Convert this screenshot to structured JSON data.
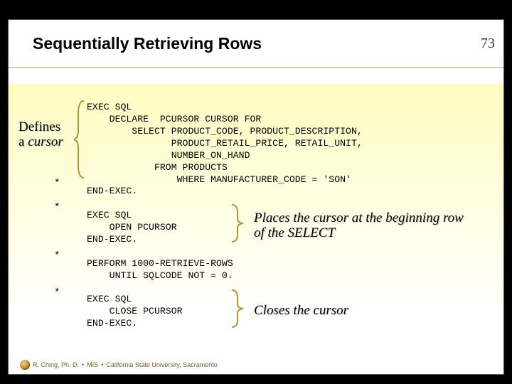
{
  "slide": {
    "title": "Sequentially Retrieving Rows",
    "page_number": "73"
  },
  "labels": {
    "defines_line1": "Defines",
    "defines_line2_prefix": "a ",
    "defines_line2_cursor": "cursor"
  },
  "stars": {
    "s1": "*",
    "s2": "*",
    "s3": "*",
    "s4": "*"
  },
  "code": {
    "block1": "EXEC SQL\n    DECLARE  PCURSOR CURSOR FOR\n        SELECT PRODUCT_CODE, PRODUCT_DESCRIPTION,\n               PRODUCT_RETAIL_PRICE, RETAIL_UNIT,\n               NUMBER_ON_HAND\n            FROM PRODUCTS\n                WHERE MANUFACTURER_CODE = 'SON'\nEND-EXEC.\n\nEXEC SQL\n    OPEN PCURSOR\nEND-EXEC.\n\nPERFORM 1000-RETRIEVE-ROWS\n    UNTIL SQLCODE NOT = 0.\n\nEXEC SQL\n    CLOSE PCURSOR\nEND-EXEC."
  },
  "annotations": {
    "places": "Places the cursor at the beginning row of the SELECT",
    "closes": "Closes the cursor"
  },
  "footer": {
    "author": "R. Ching, Ph. D.",
    "dept": "MIS",
    "org": "California State University, Sacramento",
    "bullet": "•"
  }
}
